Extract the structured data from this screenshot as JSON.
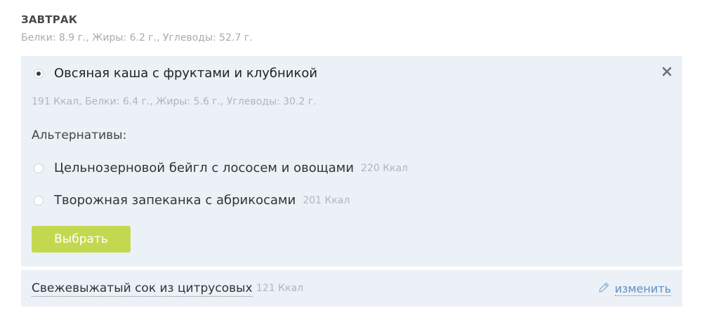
{
  "meal": {
    "title": "ЗАВТРАК",
    "macros": "Белки: 8.9 г.,   Жиры: 6.2 г.,   Углеводы: 52.7 г."
  },
  "selected_dish": {
    "name": "Овсяная каша с фруктами и клубникой",
    "macros": "191 Ккал,   Белки: 6.4 г.,   Жиры: 5.6 г.,   Углеводы: 30.2 г.",
    "close_icon": "close-icon"
  },
  "alternatives": {
    "title": "Альтернативы:",
    "items": [
      {
        "name": "Цельнозерновой бейгл с лососем и овощами",
        "kcal": "220 Ккал"
      },
      {
        "name": "Творожная запеканка с абрикосами",
        "kcal": "201 Ккал"
      }
    ]
  },
  "choose_button": {
    "label": "Выбрать"
  },
  "extra_dish": {
    "name": "Свежевыжатый сок из цитрусовых",
    "kcal": "121 Ккал",
    "edit_label": "изменить",
    "edit_icon": "pencil-icon"
  },
  "colors": {
    "card_bg": "#ecf0f7",
    "button": "#c4d84f",
    "link": "#5a8fc8"
  }
}
